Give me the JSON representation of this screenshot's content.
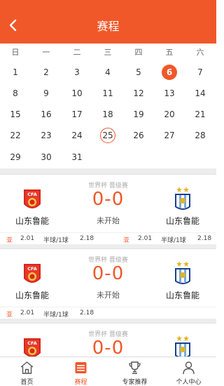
{
  "header": {
    "title": "赛程"
  },
  "calendar": {
    "weekdays": [
      "日",
      "一",
      "二",
      "三",
      "四",
      "五",
      "六"
    ],
    "selected_day": "6",
    "today_day": "25",
    "weeks": [
      [
        "1",
        "2",
        "3",
        "4",
        "5",
        "6",
        "7"
      ],
      [
        "8",
        "9",
        "10",
        "11",
        "12",
        "13",
        "14"
      ],
      [
        "15",
        "16",
        "17",
        "18",
        "19",
        "20",
        "21"
      ],
      [
        "22",
        "23",
        "24",
        "25",
        "26",
        "27",
        "28"
      ],
      [
        "29",
        "30",
        "31",
        "",
        "",
        "",
        ""
      ]
    ]
  },
  "matches": [
    {
      "league": "世界杯  晋级赛",
      "score": "0-0",
      "status": "未开始",
      "home": {
        "name": "山东鲁能",
        "logo": "cfa-crest-icon"
      },
      "away": {
        "name": "山东鲁能",
        "logo": "argentina-crest-icon"
      },
      "odds": {
        "tag_left": "亚",
        "odd1": "2.01",
        "handicap_left": "半球/1球",
        "odd2": "2.18",
        "tag_right": "亚",
        "odd3": "2.01",
        "handicap_right": "半球/1球",
        "odd4": "2.18"
      }
    },
    {
      "league": "世界杯  晋级赛",
      "score": "0-0",
      "status": "未开始",
      "home": {
        "name": "山东鲁能",
        "logo": "cfa-crest-icon"
      },
      "away": {
        "name": "山东鲁能",
        "logo": "argentina-crest-icon"
      },
      "odds": {
        "tag_left": "亚",
        "odd1": "2.01",
        "handicap_left": "半球/1球",
        "odd2": "2.18"
      }
    },
    {
      "league": "世界杯  晋级赛",
      "score": "0-0",
      "status": "",
      "home": {
        "name": "",
        "logo": "cfa-crest-icon"
      },
      "away": {
        "name": "",
        "logo": "argentina-crest-icon"
      },
      "odds": {}
    }
  ],
  "tabbar": [
    {
      "label": "首页",
      "icon": "home-icon"
    },
    {
      "label": "赛程",
      "icon": "schedule-icon"
    },
    {
      "label": "专家推荐",
      "icon": "trophy-icon"
    },
    {
      "label": "个人中心",
      "icon": "user-icon"
    }
  ],
  "colors": {
    "accent": "#f0582a",
    "separator": "#ededed"
  }
}
